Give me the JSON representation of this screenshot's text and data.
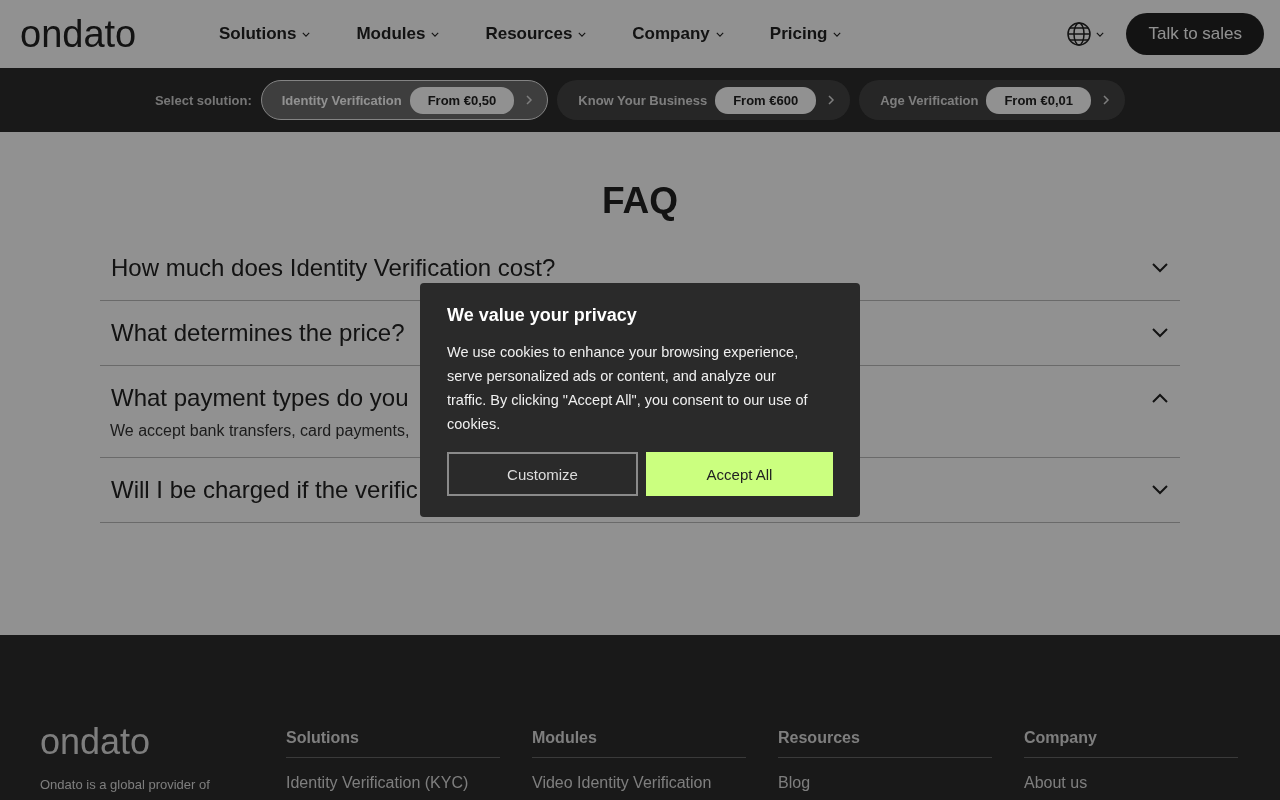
{
  "header": {
    "logo": "ondato",
    "nav": [
      {
        "label": "Solutions"
      },
      {
        "label": "Modules"
      },
      {
        "label": "Resources"
      },
      {
        "label": "Company"
      },
      {
        "label": "Pricing"
      }
    ],
    "cta": "Talk to sales"
  },
  "solution_bar": {
    "label": "Select solution:",
    "options": [
      {
        "name": "Identity Verification",
        "price": "From €0,50",
        "selected": true
      },
      {
        "name": "Know Your Business",
        "price": "From €600",
        "selected": false
      },
      {
        "name": "Age Verification",
        "price": "From €0,01",
        "selected": false
      }
    ]
  },
  "faq": {
    "title": "FAQ",
    "items": [
      {
        "question": "How much does Identity Verification cost?",
        "expanded": false
      },
      {
        "question": "What determines the price?",
        "expanded": false
      },
      {
        "question": "What payment types do you",
        "expanded": true,
        "answer": "We accept bank transfers, card payments,"
      },
      {
        "question": "Will I be charged if the verific",
        "expanded": false
      }
    ]
  },
  "footer": {
    "logo": "ondato",
    "about": "Ondato is a global provider of",
    "columns": [
      {
        "title": "Solutions",
        "link": "Identity Verification (KYC)"
      },
      {
        "title": "Modules",
        "link": "Video Identity Verification"
      },
      {
        "title": "Resources",
        "link": "Blog"
      },
      {
        "title": "Company",
        "link": "About us"
      }
    ]
  },
  "cookie_dialog": {
    "title": "We value your privacy",
    "text": "We use cookies to enhance your browsing experience, serve personalized ads or content, and analyze our traffic. By clicking \"Accept All\", you consent to our use of cookies.",
    "buttons": [
      {
        "label": "Customize",
        "kind": "secondary"
      },
      {
        "label": "Accept All",
        "kind": "primary"
      }
    ]
  }
}
